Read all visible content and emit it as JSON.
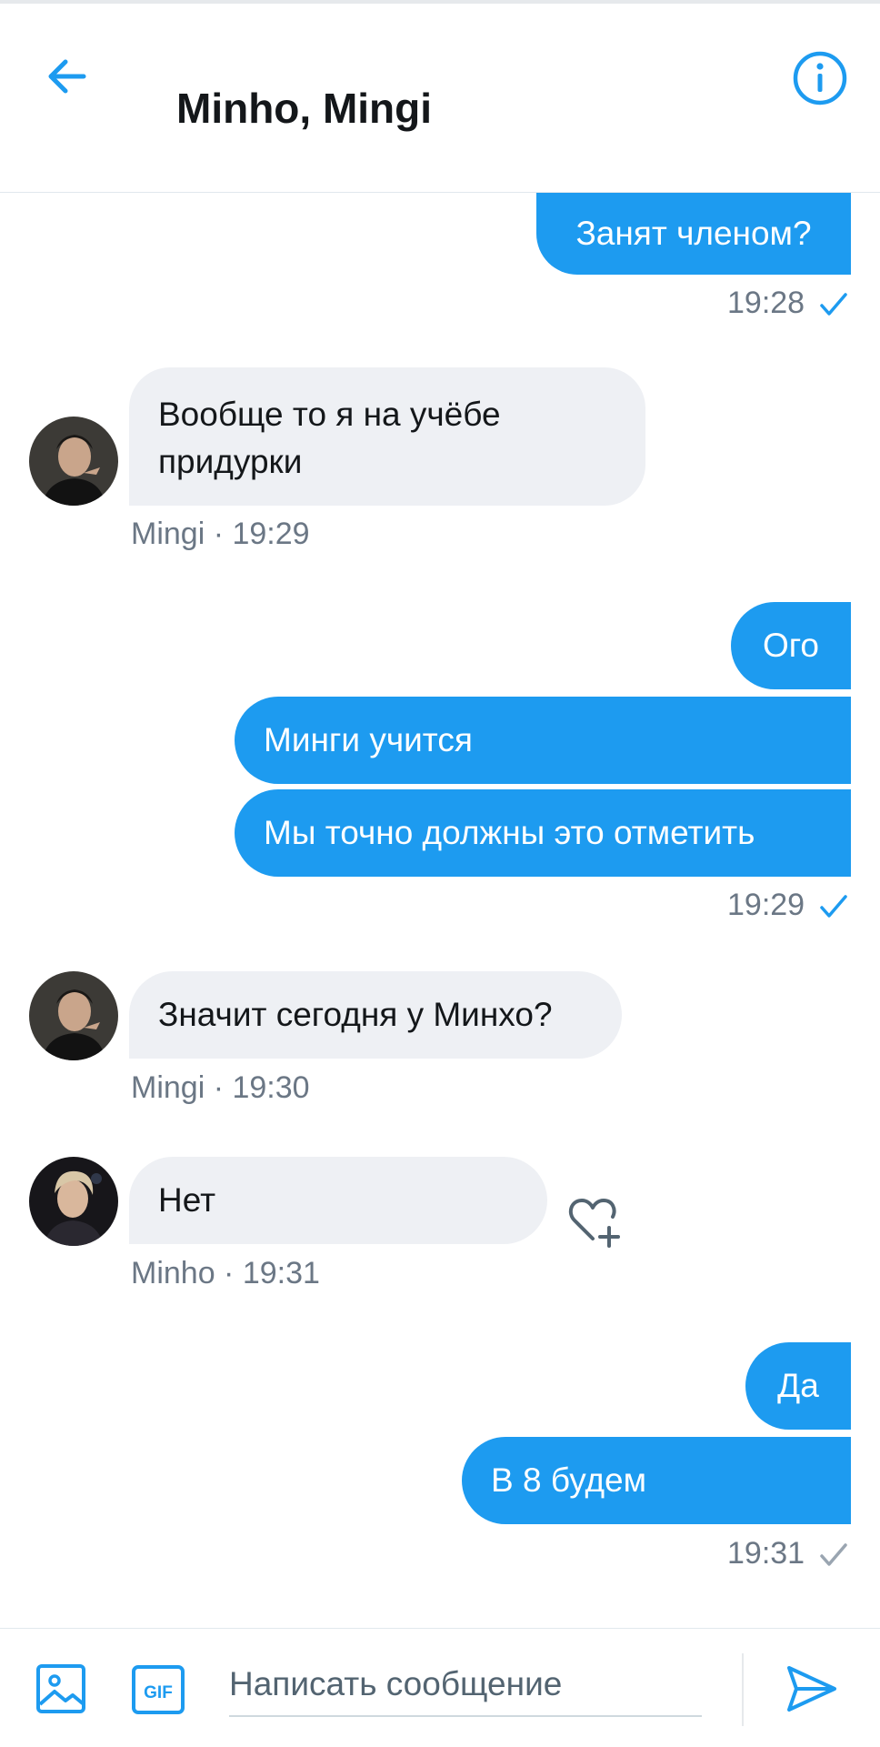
{
  "header": {
    "title": "Minho, Mingi",
    "back_icon": "arrow-left-icon",
    "info_icon": "info-circle-icon"
  },
  "messages": [
    {
      "id": "m1",
      "direction": "outgoing",
      "text": "Занят членом?"
    },
    {
      "id": "t1",
      "type": "timestamp",
      "time": "19:28",
      "status": "read"
    },
    {
      "id": "m2",
      "direction": "incoming",
      "sender": "Mingi",
      "text": "Вообще то я на учёбе придурки",
      "meta": "Mingi · 19:29"
    },
    {
      "id": "m3",
      "direction": "outgoing",
      "text": "Ого"
    },
    {
      "id": "m4",
      "direction": "outgoing",
      "text": "Минги учится"
    },
    {
      "id": "m5",
      "direction": "outgoing",
      "text": "Мы точно должны это отметить"
    },
    {
      "id": "t2",
      "type": "timestamp",
      "time": "19:29",
      "status": "read"
    },
    {
      "id": "m6",
      "direction": "incoming",
      "sender": "Mingi",
      "text": "Значит сегодня у Минхо?",
      "meta": "Mingi · 19:30"
    },
    {
      "id": "m7",
      "direction": "incoming",
      "sender": "Minho",
      "text": "Нет",
      "meta": "Minho · 19:31"
    },
    {
      "id": "m8",
      "direction": "outgoing",
      "text": "Да"
    },
    {
      "id": "m9",
      "direction": "outgoing",
      "text": "В 8 будем"
    },
    {
      "id": "t3",
      "type": "timestamp",
      "time": "19:31",
      "status": "sent"
    }
  ],
  "composer": {
    "placeholder": "Написать сообщение",
    "gif_label": "GIF"
  },
  "colors": {
    "accent": "#1d9bf0",
    "incoming_bubble": "#eef0f4",
    "read_check": "#1d9bf0",
    "sent_check": "#9aa5b1"
  }
}
